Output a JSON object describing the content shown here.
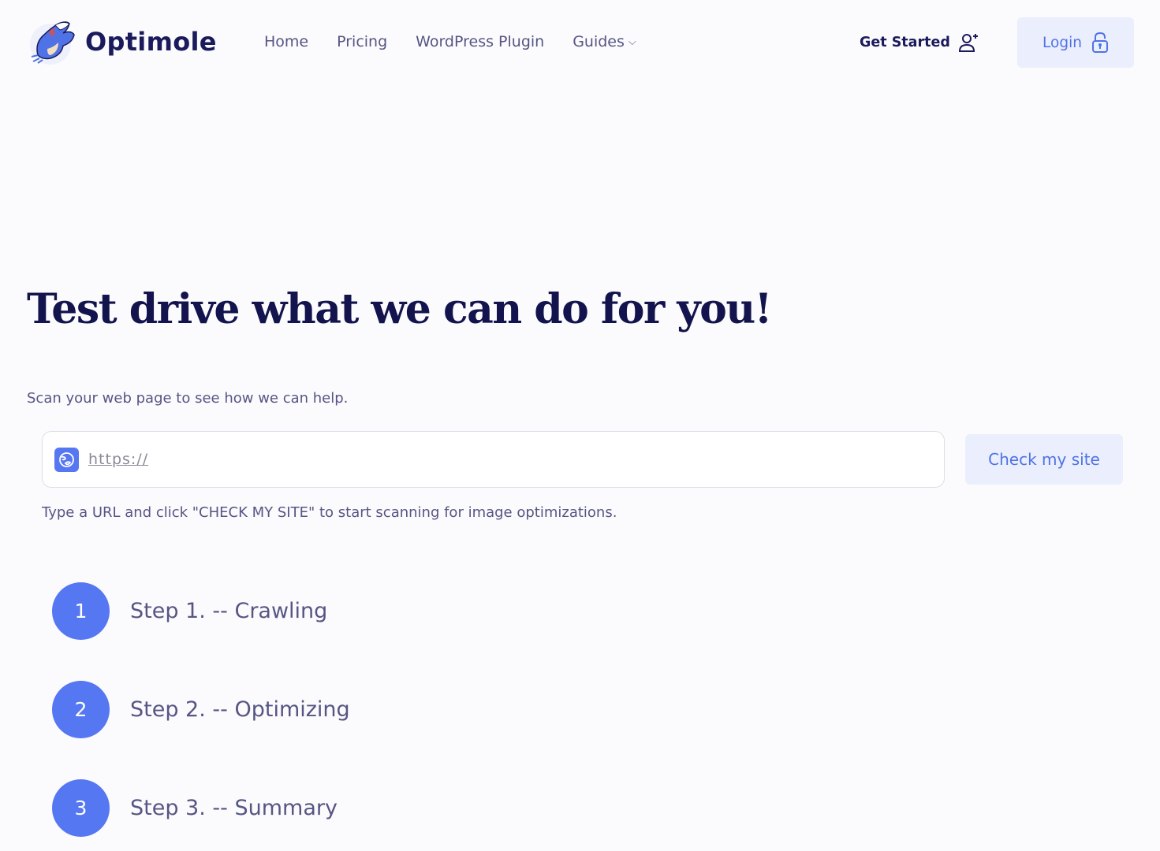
{
  "header": {
    "brand": "Optimole",
    "nav": [
      {
        "label": "Home"
      },
      {
        "label": "Pricing"
      },
      {
        "label": "WordPress Plugin"
      },
      {
        "label": "Guides",
        "icon": "chevron-down-icon"
      }
    ],
    "get_started": {
      "label": "Get Started",
      "icon": "user-plus-icon"
    },
    "login": {
      "label": "Login",
      "icon": "lock-icon"
    }
  },
  "hero": {
    "title": "Test drive what we can do for you!",
    "subtitle": "Scan your web page to see how we can help."
  },
  "scan": {
    "url_placeholder": "https://",
    "url_value": "",
    "icon": "globe-icon",
    "button_label": "Check my site",
    "helper_text": "Type a URL and click \"CHECK MY SITE\" to start scanning for image optimizations."
  },
  "steps": [
    {
      "number": "1",
      "label": "Step 1. -- Crawling"
    },
    {
      "number": "2",
      "label": "Step 2. -- Optimizing"
    },
    {
      "number": "3",
      "label": "Step 3. -- Summary"
    }
  ],
  "colors": {
    "brand_dark": "#13134d",
    "accent": "#5677f2",
    "button_bg": "#ebeefd",
    "text": "#565584"
  }
}
